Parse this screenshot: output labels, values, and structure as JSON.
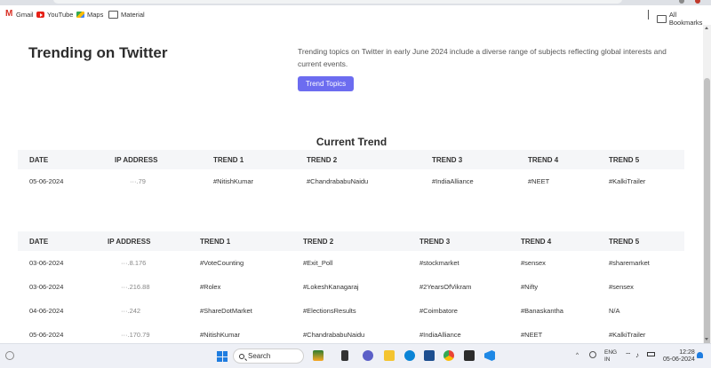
{
  "bookmarks": {
    "items": [
      {
        "label": "Gmail",
        "icon": "gmail-icon"
      },
      {
        "label": "YouTube",
        "icon": "youtube-icon"
      },
      {
        "label": "Maps",
        "icon": "maps-icon"
      },
      {
        "label": "Material",
        "icon": "folder-icon"
      }
    ],
    "all_bookmarks": "All Bookmarks"
  },
  "page": {
    "heading": "Trending on Twitter",
    "description": "Trending topics on Twitter in early June 2024 include a diverse range of subjects reflecting global interests and current events.",
    "button_label": "Trend Topics",
    "accent_color": "#6c6cf0"
  },
  "current_trend": {
    "title": "Current Trend",
    "headers": [
      "DATE",
      "IP ADDRESS",
      "TREND 1",
      "TREND 2",
      "TREND 3",
      "TREND 4",
      "TREND 5"
    ],
    "rows": [
      [
        "05-06-2024",
        "···.79",
        "#NitishKumar",
        "#ChandrababuNaidu",
        "#IndiaAlliance",
        "#NEET",
        "#KalkiTrailer"
      ]
    ]
  },
  "history": {
    "headers": [
      "DATE",
      "IP ADDRESS",
      "TREND 1",
      "TREND 2",
      "TREND 3",
      "TREND 4",
      "TREND 5"
    ],
    "rows": [
      [
        "03-06-2024",
        "···.8.176",
        "#VoteCounting",
        "#Exit_Poll",
        "#stockmarket",
        "#sensex",
        "#sharemarket"
      ],
      [
        "03-06-2024",
        "···.216.88",
        "#Rolex",
        "#LokeshKanagaraj",
        "#2YearsOfVikram",
        "#Nifty",
        "#sensex"
      ],
      [
        "04-06-2024",
        "···.242",
        "#ShareDotMarket",
        "#ElectionsResults",
        "#Coimbatore",
        "#Banaskantha",
        "N/A"
      ],
      [
        "05-06-2024",
        "···.170.79",
        "#NitishKumar",
        "#ChandrababuNaidu",
        "#IndiaAlliance",
        "#NEET",
        "#KalkiTrailer"
      ]
    ]
  },
  "taskbar": {
    "search_label": "Search",
    "lang_line1": "ENG",
    "lang_line2": "IN",
    "time": "12:28",
    "date": "05-06-2024"
  }
}
